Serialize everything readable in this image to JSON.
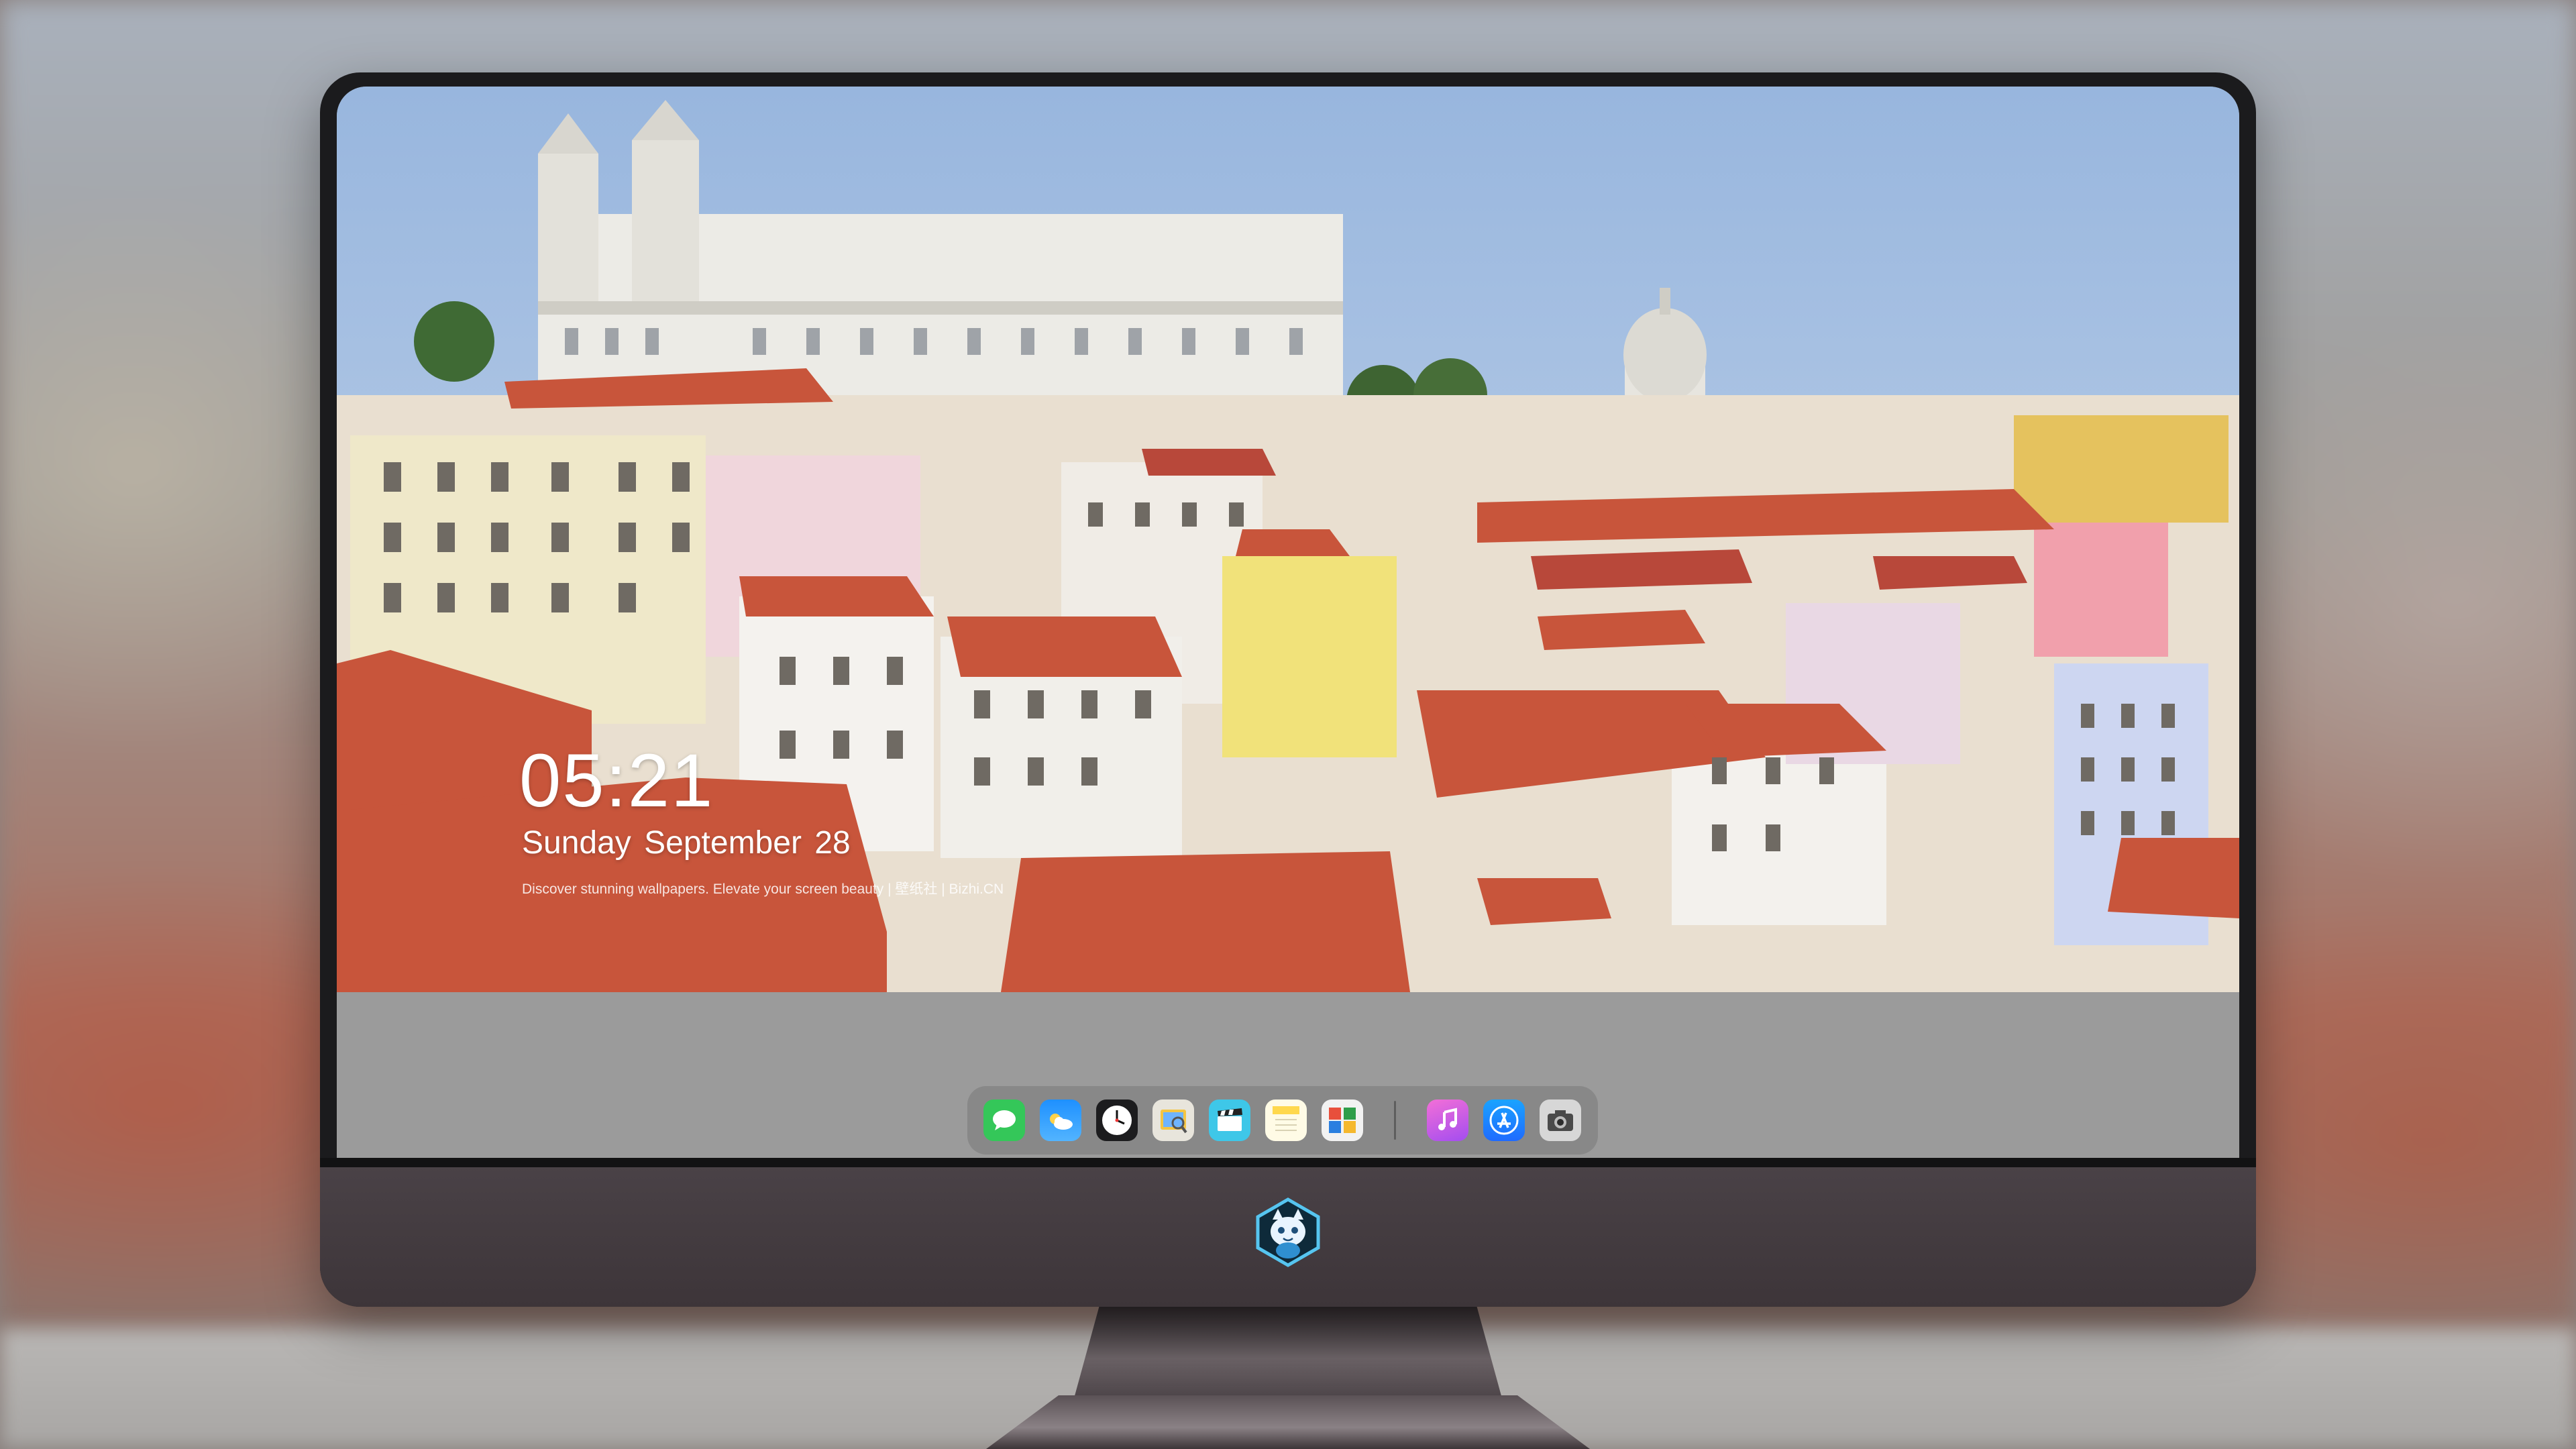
{
  "lock_screen": {
    "time": "05:21",
    "date": "Sunday September  28",
    "tagline": "Discover stunning wallpapers. Elevate your screen beauty  |  壁纸社  |  Bizhi.CN"
  },
  "dock": {
    "items": [
      {
        "name": "messages",
        "icon": "message-bubble-icon",
        "color": "#34c759"
      },
      {
        "name": "weather",
        "icon": "cloud-icon",
        "color": "#1e90ff"
      },
      {
        "name": "clock",
        "icon": "clock-icon",
        "color": "#ffffff"
      },
      {
        "name": "preview",
        "icon": "preview-icon",
        "color": "#f5c542"
      },
      {
        "name": "clips",
        "icon": "clapperboard-icon",
        "color": "#3ec7e8"
      },
      {
        "name": "notes",
        "icon": "notes-icon",
        "color": "#ffd84d"
      },
      {
        "name": "photo-booth",
        "icon": "photos-icon",
        "color": "#e84f3c"
      },
      {
        "name": "itunes",
        "icon": "music-note-icon",
        "color": "#d54ce0"
      },
      {
        "name": "app-store",
        "icon": "app-store-icon",
        "color": "#1f8bff"
      },
      {
        "name": "camera",
        "icon": "camera-icon",
        "color": "#5a5a5a"
      }
    ]
  },
  "colors": {
    "sky": "#a9c4e6",
    "roof": "#c9523a",
    "bezel": "#1b1b1d",
    "chin": "#453d41"
  },
  "brand_icon": "cat-mascot-logo-icon"
}
